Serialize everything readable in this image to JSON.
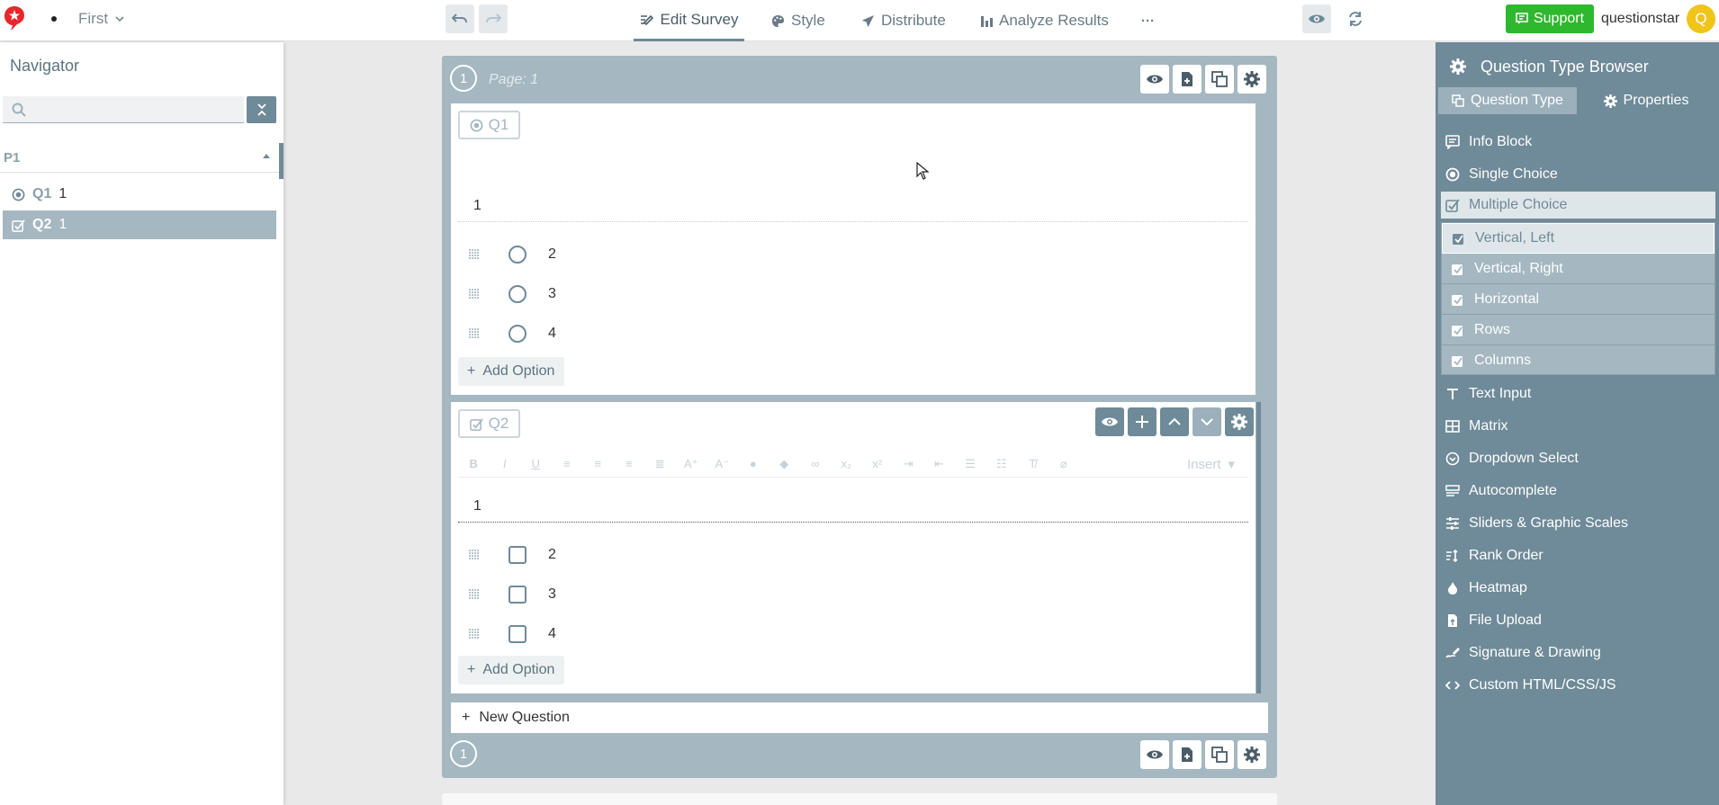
{
  "topbar": {
    "survey_name": "First",
    "nav": [
      {
        "label": "Edit Survey",
        "icon": "edit-icon",
        "active": true
      },
      {
        "label": "Style",
        "icon": "palette-icon",
        "active": false
      },
      {
        "label": "Distribute",
        "icon": "send-icon",
        "active": false
      },
      {
        "label": "Analyze Results",
        "icon": "bar-chart-icon",
        "active": false
      }
    ],
    "more_label": "···",
    "support_label": "Support",
    "username": "questionstar",
    "avatar_letter": "Q"
  },
  "navigator": {
    "title": "Navigator",
    "search_placeholder": "",
    "page_label": "P1",
    "questions": [
      {
        "id": "Q1",
        "text": "1",
        "icon": "radio-icon",
        "selected": false
      },
      {
        "id": "Q2",
        "text": "1",
        "icon": "checkbox-icon",
        "selected": true
      }
    ]
  },
  "page": {
    "number": "1",
    "label": "Page: 1",
    "q1": {
      "badge": "Q1",
      "text": "1",
      "options": [
        "2",
        "3",
        "4"
      ],
      "add_option_label": "Add Option"
    },
    "q2": {
      "badge": "Q2",
      "text": "1",
      "options": [
        "2",
        "3",
        "4"
      ],
      "add_option_label": "Add Option",
      "insert_label": "Insert"
    },
    "new_question_label": "New Question",
    "footer_number": "1"
  },
  "right_panel": {
    "title": "Question Type Browser",
    "tabs": [
      {
        "label": "Question Type",
        "active": true
      },
      {
        "label": "Properties",
        "active": false
      }
    ],
    "types_top": [
      {
        "label": "Info Block",
        "icon": "info-block-icon"
      },
      {
        "label": "Single Choice",
        "icon": "radio-icon"
      },
      {
        "label": "Multiple Choice",
        "icon": "checkbox-icon",
        "active": true
      }
    ],
    "sub_types": [
      {
        "label": "Vertical, Left",
        "active": true
      },
      {
        "label": "Vertical, Right",
        "active": false
      },
      {
        "label": "Horizontal",
        "active": false
      },
      {
        "label": "Rows",
        "active": false
      },
      {
        "label": "Columns",
        "active": false
      }
    ],
    "types_bottom": [
      {
        "label": "Text Input",
        "icon": "text-icon"
      },
      {
        "label": "Matrix",
        "icon": "matrix-icon"
      },
      {
        "label": "Dropdown Select",
        "icon": "dropdown-icon"
      },
      {
        "label": "Autocomplete",
        "icon": "autocomplete-icon"
      },
      {
        "label": "Sliders & Graphic Scales",
        "icon": "sliders-icon"
      },
      {
        "label": "Rank Order",
        "icon": "rank-icon"
      },
      {
        "label": "Heatmap",
        "icon": "heatmap-icon"
      },
      {
        "label": "File Upload",
        "icon": "file-upload-icon"
      },
      {
        "label": "Signature & Drawing",
        "icon": "signature-icon"
      },
      {
        "label": "Custom HTML/CSS/JS",
        "icon": "code-icon"
      }
    ]
  },
  "colors": {
    "accent": "#6f8a98",
    "page_bg": "#a5b7c0",
    "support_green": "#2eb82e",
    "avatar_yellow": "#f0c419",
    "logo_red": "#e8262b"
  }
}
